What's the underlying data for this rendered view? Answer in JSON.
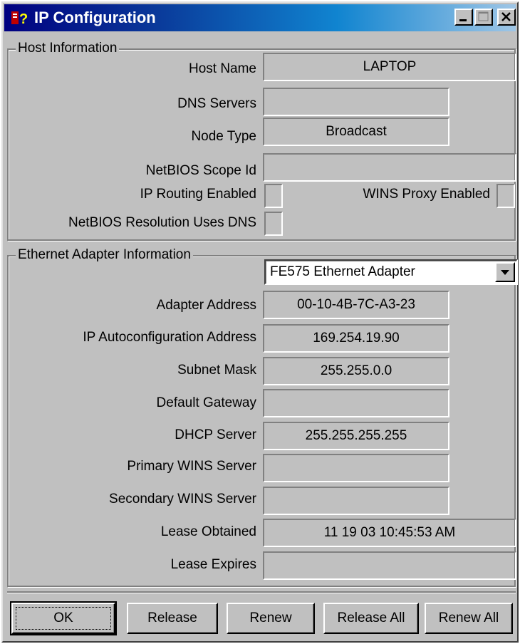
{
  "window": {
    "title": "IP Configuration"
  },
  "host_info": {
    "group_title": "Host Information",
    "host_name": {
      "label": "Host Name",
      "value": "LAPTOP"
    },
    "dns_servers": {
      "label": "DNS Servers",
      "value": ""
    },
    "node_type": {
      "label": "Node Type",
      "value": "Broadcast"
    },
    "netbios_scope_id": {
      "label": "NetBIOS Scope Id",
      "value": ""
    },
    "ip_routing": {
      "label": "IP Routing Enabled",
      "checked": false
    },
    "wins_proxy": {
      "label": "WINS Proxy Enabled",
      "checked": false
    },
    "netbios_dns": {
      "label": "NetBIOS Resolution Uses DNS",
      "checked": false
    }
  },
  "adapter_info": {
    "group_title": "Ethernet  Adapter Information",
    "adapter_select": "FE575 Ethernet Adapter",
    "adapter_address": {
      "label": "Adapter Address",
      "value": "00-10-4B-7C-A3-23"
    },
    "ip_autoconfig": {
      "label": "IP Autoconfiguration Address",
      "value": "169.254.19.90"
    },
    "subnet_mask": {
      "label": "Subnet Mask",
      "value": "255.255.0.0"
    },
    "default_gateway": {
      "label": "Default Gateway",
      "value": ""
    },
    "dhcp_server": {
      "label": "DHCP Server",
      "value": "255.255.255.255"
    },
    "primary_wins": {
      "label": "Primary WINS Server",
      "value": ""
    },
    "secondary_wins": {
      "label": "Secondary WINS Server",
      "value": ""
    },
    "lease_obtained": {
      "label": "Lease Obtained",
      "value": "11 19 03 10:45:53 AM"
    },
    "lease_expires": {
      "label": "Lease Expires",
      "value": ""
    }
  },
  "buttons": {
    "ok": "OK",
    "release": "Release",
    "renew": "Renew",
    "release_all": "Release All",
    "renew_all": "Renew All"
  },
  "colors": {
    "face": "#c0c0c0",
    "title_start": "#000080",
    "title_end": "#9fc6e6"
  }
}
